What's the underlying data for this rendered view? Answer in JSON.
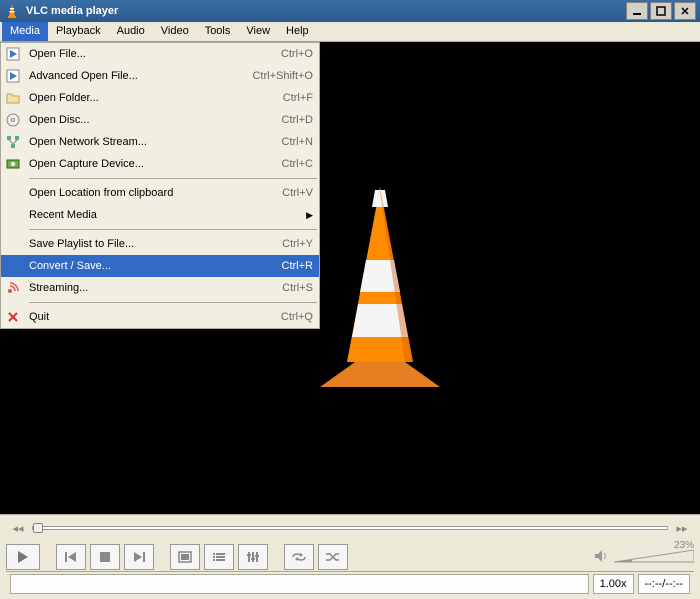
{
  "title": "VLC media player",
  "menubar": [
    "Media",
    "Playback",
    "Audio",
    "Video",
    "Tools",
    "View",
    "Help"
  ],
  "activeMenu": 0,
  "media_menu": [
    {
      "icon": "play-file",
      "label": "Open File...",
      "shortcut": "Ctrl+O"
    },
    {
      "icon": "play-file",
      "label": "Advanced Open File...",
      "shortcut": "Ctrl+Shift+O"
    },
    {
      "icon": "folder",
      "label": "Open Folder...",
      "shortcut": "Ctrl+F"
    },
    {
      "icon": "disc",
      "label": "Open Disc...",
      "shortcut": "Ctrl+D"
    },
    {
      "icon": "network",
      "label": "Open Network Stream...",
      "shortcut": "Ctrl+N"
    },
    {
      "icon": "capture",
      "label": "Open Capture Device...",
      "shortcut": "Ctrl+C"
    },
    {
      "sep": true
    },
    {
      "icon": "",
      "label": "Open Location from clipboard",
      "shortcut": "Ctrl+V"
    },
    {
      "icon": "",
      "label": "Recent Media",
      "shortcut": "",
      "submenu": true
    },
    {
      "sep": true
    },
    {
      "icon": "",
      "label": "Save Playlist to File...",
      "shortcut": "Ctrl+Y"
    },
    {
      "icon": "",
      "label": "Convert / Save...",
      "shortcut": "Ctrl+R",
      "highlight": true
    },
    {
      "icon": "stream",
      "label": "Streaming...",
      "shortcut": "Ctrl+S"
    },
    {
      "sep": true
    },
    {
      "icon": "quit",
      "label": "Quit",
      "shortcut": "Ctrl+Q"
    }
  ],
  "volume_percent": "23%",
  "speed": "1.00x",
  "time_display": "--:--/--:--"
}
